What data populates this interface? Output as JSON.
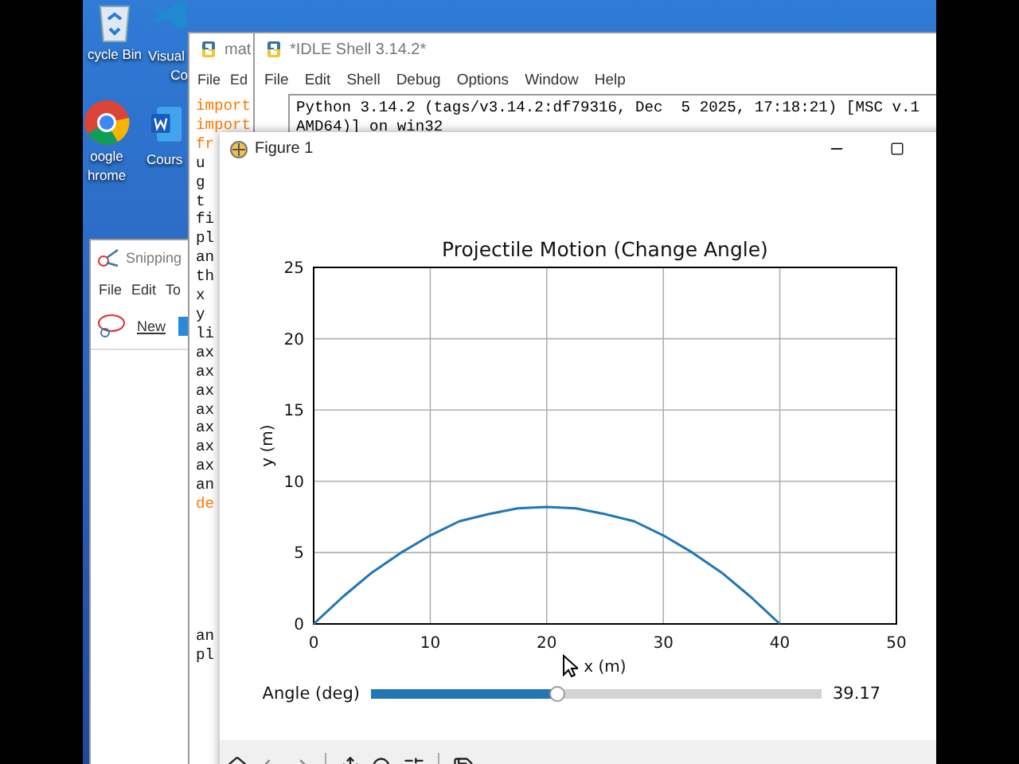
{
  "desktop_icons": [
    {
      "kind": "recycle",
      "lines": [
        "cycle Bin"
      ]
    },
    {
      "kind": "vscode",
      "lines": [
        "Visual",
        "Co"
      ]
    },
    {
      "kind": "chrome",
      "lines": [
        "oogle",
        "hrome"
      ]
    },
    {
      "kind": "word",
      "lines": [
        "Cours"
      ]
    }
  ],
  "snipping_tool": {
    "title": "Snipping",
    "menu": [
      "File",
      "Edit",
      "To"
    ],
    "new_button": "New"
  },
  "editor": {
    "title": "mat",
    "menu": [
      "File",
      "Ed"
    ],
    "code_lines": [
      {
        "kind": "keyword",
        "text": "import"
      },
      {
        "kind": "keyword",
        "text": "import"
      },
      {
        "kind": "keyword",
        "text": "fr"
      },
      {
        "kind": "plain",
        "text": "u"
      },
      {
        "kind": "plain",
        "text": "g"
      },
      {
        "kind": "plain",
        "text": "t"
      },
      {
        "kind": "plain",
        "text": "fi"
      },
      {
        "kind": "plain",
        "text": "pl"
      },
      {
        "kind": "plain",
        "text": "an"
      },
      {
        "kind": "plain",
        "text": "th"
      },
      {
        "kind": "plain",
        "text": "x"
      },
      {
        "kind": "plain",
        "text": "y"
      },
      {
        "kind": "plain",
        "text": "li"
      },
      {
        "kind": "plain",
        "text": "ax"
      },
      {
        "kind": "plain",
        "text": "ax"
      },
      {
        "kind": "plain",
        "text": "ax"
      },
      {
        "kind": "plain",
        "text": "ax"
      },
      {
        "kind": "plain",
        "text": "ax"
      },
      {
        "kind": "plain",
        "text": "ax"
      },
      {
        "kind": "plain",
        "text": "ax"
      },
      {
        "kind": "plain",
        "text": "an"
      },
      {
        "kind": "keyword",
        "text": "de"
      }
    ],
    "code_tail": [
      {
        "kind": "plain",
        "text": "an"
      },
      {
        "kind": "plain",
        "text": "pl"
      }
    ]
  },
  "idle_shell": {
    "title": "*IDLE Shell 3.14.2*",
    "menu": [
      "File",
      "Edit",
      "Shell",
      "Debug",
      "Options",
      "Window",
      "Help"
    ],
    "output": [
      "Python 3.14.2 (tags/v3.14.2:df79316, Dec  5 2025, 17:18:21) [MSC v.1",
      "AMD64)] on win32"
    ]
  },
  "figure": {
    "title": "Figure 1",
    "chart_data": {
      "type": "line",
      "title": "Projectile Motion (Change Angle)",
      "xlabel": "x (m)",
      "ylabel": "y (m)",
      "grid": true,
      "x": [
        0,
        2.5,
        5,
        7.5,
        10,
        12.5,
        15,
        17.5,
        20,
        22.5,
        25,
        27.5,
        30,
        32.5,
        35,
        37.5,
        40
      ],
      "series": [
        {
          "color": "#1f77b4",
          "values": [
            0,
            1.9,
            3.6,
            5.0,
            6.2,
            7.2,
            7.7,
            8.1,
            8.2,
            8.1,
            7.7,
            7.2,
            6.2,
            5.0,
            3.6,
            1.9,
            0
          ]
        }
      ],
      "xlim": [
        0,
        50
      ],
      "ylim": [
        0,
        25
      ],
      "xticks": [
        0,
        10,
        20,
        30,
        40,
        50
      ],
      "yticks": [
        0,
        5,
        10,
        15,
        20,
        25
      ]
    },
    "slider": {
      "label": "Angle (deg)",
      "level": 0.413,
      "reading": "39.17"
    }
  }
}
